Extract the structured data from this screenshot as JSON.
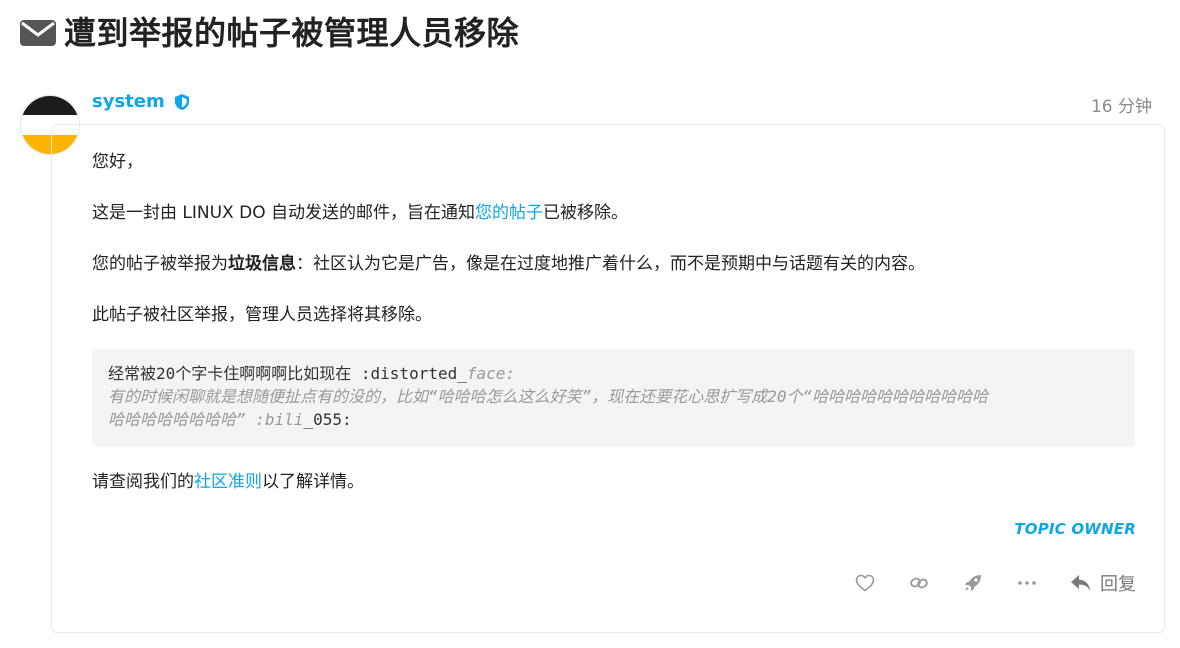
{
  "topic": {
    "title": "遭到举报的帖子被管理人员移除"
  },
  "post": {
    "username": "system",
    "time_ago": "16 分钟",
    "greeting": "您好，",
    "line2_before": "这是一封由 LINUX DO 自动发送的邮件，旨在通知",
    "line2_link": "您的帖子",
    "line2_after": "已被移除。",
    "line3_before": "您的帖子被举报为",
    "line3_bold": "垃圾信息",
    "line3_after": "：社区认为它是广告，像是在过度地推广着什么，而不是预期中与话题有关的内容。",
    "line4": "此帖子被社区举报，管理人员选择将其移除。",
    "quote": {
      "line1_plain": "经常被20个字卡住啊啊啊比如现在 :distorted_",
      "line1_italic": "face:",
      "line2_italic": "有的时候闲聊就是想随便扯点有的没的，比如“哈哈哈怎么这么好笑”，现在还要花心思扩写成20个“哈哈哈哈哈哈哈哈哈哈哈",
      "line3_italic": "哈哈哈哈哈哈哈哈” :bili",
      "line3_plain": "_055:"
    },
    "footer_before": "请查阅我们的",
    "footer_link": "社区准则",
    "footer_after": "以了解详情。",
    "owner_badge": "TOPIC OWNER",
    "reply_label": "回复"
  },
  "icons": {
    "title": "envelope-icon",
    "moderator": "shield-icon",
    "like": "heart-icon",
    "copy_link": "link-icon",
    "boost": "rocket-icon",
    "more": "ellipsis-icon",
    "reply": "reply-icon"
  },
  "colors": {
    "accent": "#0ea5e9",
    "muted": "#9a9a9a",
    "avatar_top": "#1c1c1c",
    "avatar_mid": "#ffffff",
    "avatar_bottom": "#ffb400"
  }
}
